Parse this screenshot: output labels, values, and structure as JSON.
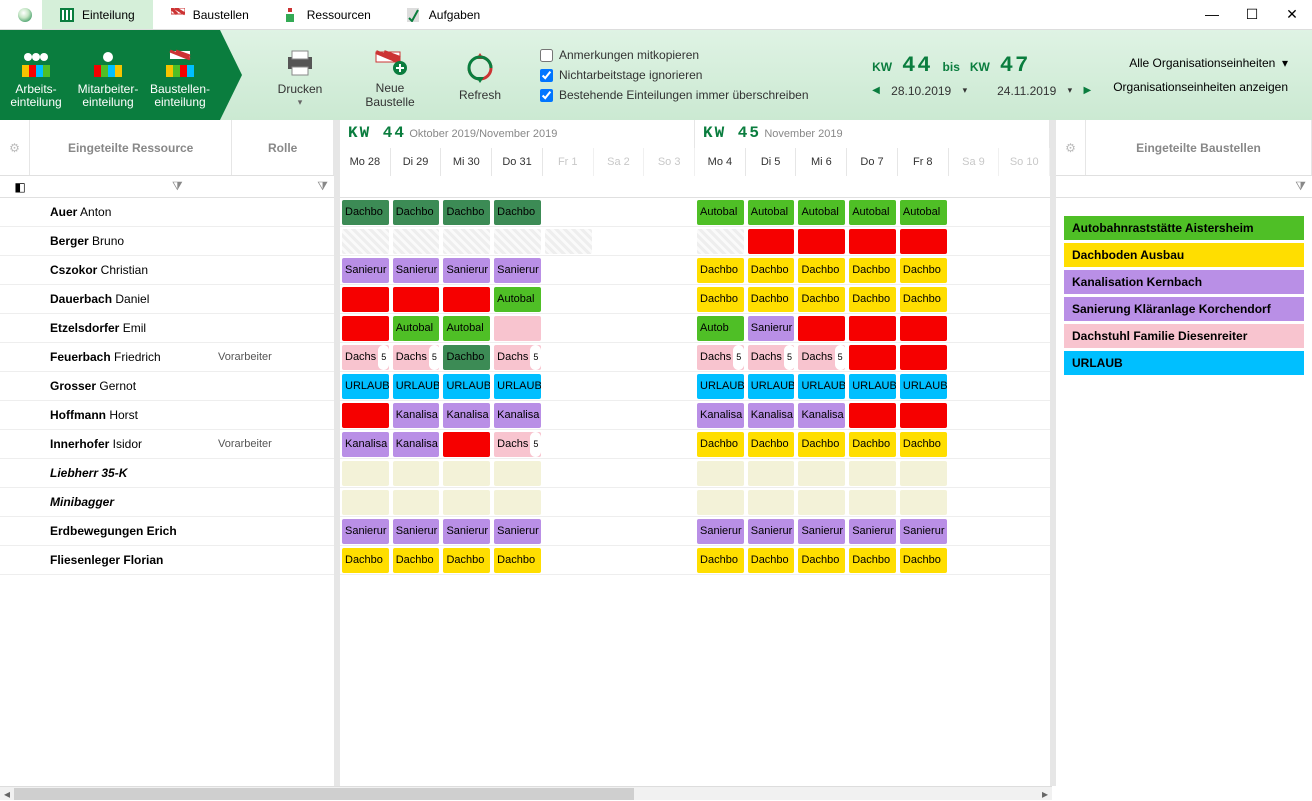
{
  "window_tabs": [
    {
      "label": "Einteilung",
      "active": true
    },
    {
      "label": "Baustellen",
      "active": false
    },
    {
      "label": "Ressourcen",
      "active": false
    },
    {
      "label": "Aufgaben",
      "active": false
    }
  ],
  "ribbon": {
    "left": [
      {
        "label": "Arbeits-\neinteilung"
      },
      {
        "label": "Mitarbeiter-\neinteilung"
      },
      {
        "label": "Baustellen-\neinteilung"
      }
    ],
    "actions": [
      {
        "label": "Drucken"
      },
      {
        "label": "Neue\nBaustelle"
      },
      {
        "label": "Refresh"
      }
    ],
    "checks": [
      {
        "label": "Anmerkungen mitkopieren",
        "checked": false
      },
      {
        "label": "Nichtarbeitstage ignorieren",
        "checked": true
      },
      {
        "label": "Bestehende Einteilungen immer überschreiben",
        "checked": true
      }
    ],
    "kw": {
      "from_label": "KW",
      "from": "44",
      "between": "bis",
      "to_label": "KW",
      "to": "47"
    },
    "dates": {
      "from": "28.10.2019",
      "to": "24.11.2019"
    },
    "org_combo": "Alle Organisationseinheiten",
    "org_link": "Organisationseinheiten anzeigen"
  },
  "left_header": {
    "res": "Eingeteilte Ressource",
    "role": "Rolle"
  },
  "center_header": {
    "week1": {
      "kw": "KW 44",
      "range": "Oktober 2019/November 2019"
    },
    "week2": {
      "kw": "KW 45",
      "range": "November 2019"
    },
    "days": [
      "Mo 28",
      "Di 29",
      "Mi 30",
      "Do 31",
      "Fr 1",
      "Sa 2",
      "So 3",
      "Mo 4",
      "Di 5",
      "Mi 6",
      "Do 7",
      "Fr 8",
      "Sa 9",
      "So 10"
    ]
  },
  "right_header": "Eingeteilte Baustellen",
  "sites": [
    {
      "label": "Autobahnraststätte Aistersheim",
      "cls": "c-lime"
    },
    {
      "label": "Dachboden Ausbau",
      "cls": "c-yellow"
    },
    {
      "label": "Kanalisation Kernbach",
      "cls": "c-violet"
    },
    {
      "label": "Sanierung Kläranlage Korchendorf",
      "cls": "c-violet"
    },
    {
      "label": "Dachstuhl Familie Diesenreiter",
      "cls": "c-pink"
    },
    {
      "label": "URLAUB",
      "cls": "c-cyan"
    }
  ],
  "resources": [
    {
      "last": "Auer",
      "first": "Anton",
      "role": "",
      "row": [
        [
          "Dachbo",
          "green"
        ],
        [
          "Dachbo",
          "green"
        ],
        [
          "Dachbo",
          "green"
        ],
        [
          "Dachbo",
          "green"
        ],
        null,
        null,
        null,
        [
          "Autobal",
          "lime"
        ],
        [
          "Autobal",
          "lime"
        ],
        [
          "Autobal",
          "lime"
        ],
        [
          "Autobal",
          "lime"
        ],
        [
          "Autobal",
          "lime"
        ],
        null,
        null
      ]
    },
    {
      "last": "Berger",
      "first": "Bruno",
      "role": "",
      "row": [
        "hatch",
        "hatch",
        "hatch",
        "hatch",
        "hatch",
        null,
        null,
        "hatch",
        [
          "",
          "red"
        ],
        [
          "",
          "red"
        ],
        [
          "",
          "red"
        ],
        [
          "",
          "red"
        ],
        null,
        null
      ]
    },
    {
      "last": "Cszokor",
      "first": "Christian",
      "role": "",
      "row": [
        [
          "Sanierur",
          "violet"
        ],
        [
          "Sanierur",
          "violet"
        ],
        [
          "Sanierur",
          "violet"
        ],
        [
          "Sanierur",
          "violet"
        ],
        null,
        null,
        null,
        [
          "Dachbo",
          "yellow"
        ],
        [
          "Dachbo",
          "yellow"
        ],
        [
          "Dachbo",
          "yellow"
        ],
        [
          "Dachbo",
          "yellow"
        ],
        [
          "Dachbo",
          "yellow"
        ],
        null,
        null
      ]
    },
    {
      "last": "Dauerbach",
      "first": "Daniel",
      "role": "",
      "row": [
        [
          "",
          "red"
        ],
        [
          "",
          "red"
        ],
        [
          "",
          "red"
        ],
        [
          "Autobal",
          "lime"
        ],
        null,
        null,
        null,
        [
          "Dachbo",
          "yellow"
        ],
        [
          "Dachbo",
          "yellow"
        ],
        [
          "Dachbo",
          "yellow"
        ],
        [
          "Dachbo",
          "yellow"
        ],
        [
          "Dachbo",
          "yellow"
        ],
        null,
        null
      ]
    },
    {
      "last": "Etzelsdorfer",
      "first": "Emil",
      "role": "",
      "row": [
        [
          "",
          "red"
        ],
        [
          "Autobal",
          "lime"
        ],
        [
          "Autobal",
          "lime"
        ],
        [
          "",
          "pink"
        ],
        null,
        null,
        null,
        [
          "Autob",
          "lime"
        ],
        [
          "Sanierur",
          "violet"
        ],
        [
          "",
          "red"
        ],
        [
          "",
          "red"
        ],
        [
          "",
          "red"
        ],
        null,
        null
      ]
    },
    {
      "last": "Feuerbach",
      "first": "Friedrich",
      "role": "Vorarbeiter",
      "row": [
        [
          "Dachs 5",
          "pink"
        ],
        [
          "Dachs 5",
          "pink"
        ],
        [
          "Dachbo",
          "green"
        ],
        [
          "Dachs 5",
          "pink"
        ],
        null,
        null,
        null,
        [
          "Dachs 5",
          "pink"
        ],
        [
          "Dachs 5",
          "pink"
        ],
        [
          "Dachs 5",
          "pink"
        ],
        [
          "",
          "red"
        ],
        [
          "",
          "red"
        ],
        null,
        null
      ]
    },
    {
      "last": "Grosser",
      "first": "Gernot",
      "role": "",
      "row": [
        [
          "URLAUB",
          "cyan"
        ],
        [
          "URLAUB",
          "cyan"
        ],
        [
          "URLAUB",
          "cyan"
        ],
        [
          "URLAUB",
          "cyan"
        ],
        null,
        null,
        null,
        [
          "URLAUB",
          "cyan"
        ],
        [
          "URLAUB",
          "cyan"
        ],
        [
          "URLAUB",
          "cyan"
        ],
        [
          "URLAUB",
          "cyan"
        ],
        [
          "URLAUB",
          "cyan"
        ],
        null,
        null
      ]
    },
    {
      "last": "Hoffmann",
      "first": "Horst",
      "role": "",
      "row": [
        [
          "",
          "red"
        ],
        [
          "Kanalisa",
          "violet"
        ],
        [
          "Kanalisa",
          "violet"
        ],
        [
          "Kanalisa",
          "violet"
        ],
        null,
        null,
        null,
        [
          "Kanalisa",
          "violet"
        ],
        [
          "Kanalisa",
          "violet"
        ],
        [
          "Kanalisa",
          "violet"
        ],
        [
          "",
          "red"
        ],
        [
          "",
          "red"
        ],
        null,
        null
      ]
    },
    {
      "last": "Innerhofer",
      "first": "Isidor",
      "role": "Vorarbeiter",
      "row": [
        [
          "Kanalisa",
          "violet"
        ],
        [
          "Kanalisa",
          "violet"
        ],
        [
          "",
          "red"
        ],
        [
          "Dachs 5",
          "pink"
        ],
        null,
        null,
        null,
        [
          "Dachbo",
          "yellow"
        ],
        [
          "Dachbo",
          "yellow"
        ],
        [
          "Dachbo",
          "yellow"
        ],
        [
          "Dachbo",
          "yellow"
        ],
        [
          "Dachbo",
          "yellow"
        ],
        null,
        null
      ]
    },
    {
      "last": "Liebherr 35-K",
      "first": "",
      "role": "",
      "italic": true,
      "row": [
        "pale",
        "pale",
        "pale",
        "pale",
        null,
        null,
        null,
        "pale",
        "pale",
        "pale",
        "pale",
        "pale",
        null,
        null
      ]
    },
    {
      "last": "Minibagger",
      "first": "",
      "role": "",
      "italic": true,
      "row": [
        "pale",
        "pale",
        "pale",
        "pale",
        null,
        null,
        null,
        "pale",
        "pale",
        "pale",
        "pale",
        "pale",
        null,
        null
      ]
    },
    {
      "last": "Erdbewegungen Erich",
      "first": "",
      "role": "",
      "row": [
        [
          "Sanierur",
          "violet"
        ],
        [
          "Sanierur",
          "violet"
        ],
        [
          "Sanierur",
          "violet"
        ],
        [
          "Sanierur",
          "violet"
        ],
        null,
        null,
        null,
        [
          "Sanierur",
          "violet"
        ],
        [
          "Sanierur",
          "violet"
        ],
        [
          "Sanierur",
          "violet"
        ],
        [
          "Sanierur",
          "violet"
        ],
        [
          "Sanierur",
          "violet"
        ],
        null,
        null
      ]
    },
    {
      "last": "Fliesenleger Florian",
      "first": "",
      "role": "",
      "row": [
        [
          "Dachbo",
          "yellow"
        ],
        [
          "Dachbo",
          "yellow"
        ],
        [
          "Dachbo",
          "yellow"
        ],
        [
          "Dachbo",
          "yellow"
        ],
        null,
        null,
        null,
        [
          "Dachbo",
          "yellow"
        ],
        [
          "Dachbo",
          "yellow"
        ],
        [
          "Dachbo",
          "yellow"
        ],
        [
          "Dachbo",
          "yellow"
        ],
        [
          "Dachbo",
          "yellow"
        ],
        null,
        null
      ]
    }
  ]
}
